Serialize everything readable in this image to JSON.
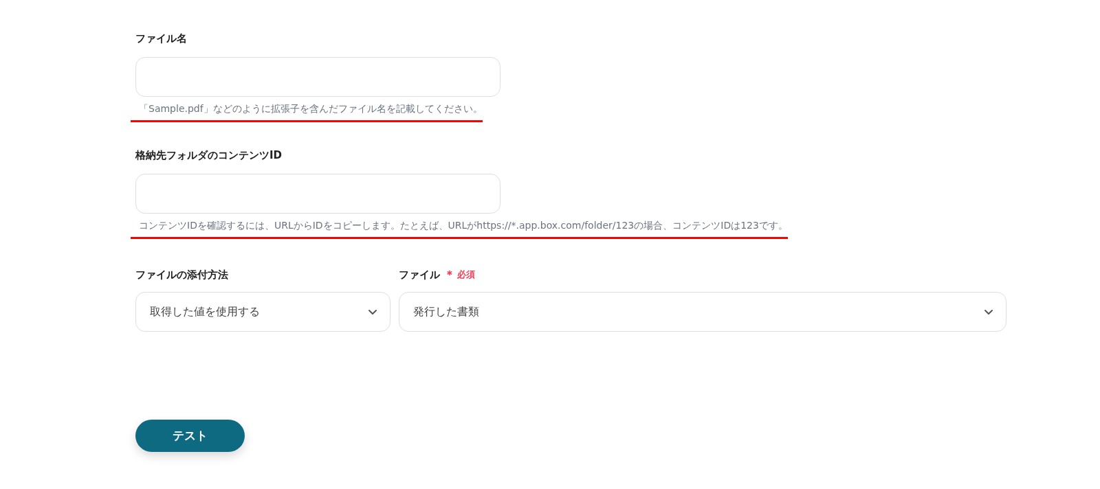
{
  "fields": [
    {
      "kind": "text",
      "label": "ファイル名",
      "hint": "「Sample.pdf」などのように拡張子を含んだファイル名を記載してください。",
      "underlined": true
    },
    {
      "kind": "text",
      "label": "格納先フォルダのコンテンツID",
      "hint": "コンテンツIDを確認するには、URLからIDをコピーします。たとえば、URLがhttps://*.app.box.com/folder/123の場合、コンテンツIDは123です。",
      "underlined": true
    }
  ],
  "selects": [
    {
      "label": "ファイルの添付方法",
      "value": "取得した値を使用する"
    },
    {
      "label": "ファイル",
      "value": "発行した書類",
      "required_mark": "＊",
      "required_text": "必須"
    }
  ],
  "button": "テスト"
}
